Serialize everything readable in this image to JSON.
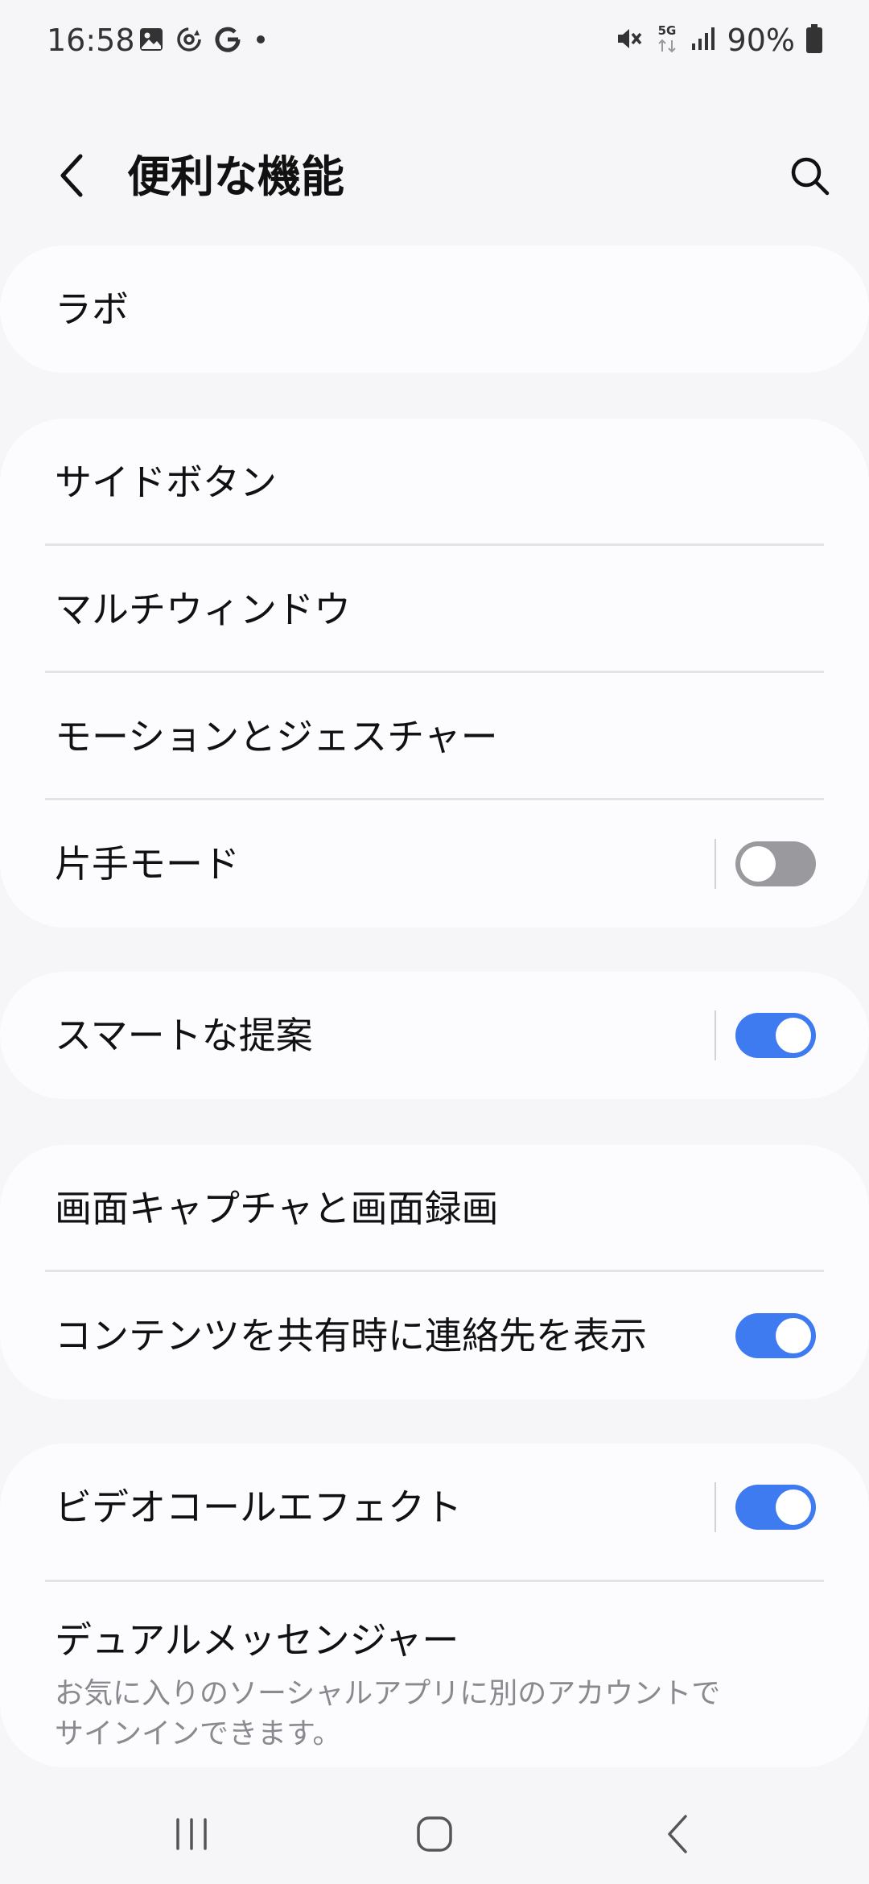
{
  "status_bar": {
    "time": "16:58",
    "left_icons": [
      "gallery-icon",
      "sync-icon",
      "google-icon",
      "dot-icon"
    ],
    "right_icons": [
      "mute-icon",
      "5g-icon",
      "signal-icon",
      "battery-icon"
    ],
    "battery": "90%",
    "network": "5G"
  },
  "header": {
    "title": "便利な機能",
    "back_icon": "chevron-left-icon",
    "search_icon": "search-icon"
  },
  "sections": {
    "labs": {
      "label": "ラボ"
    },
    "group1": {
      "side_button": "サイドボタン",
      "multi_window": "マルチウィンドウ",
      "motions": "モーションとジェスチャー",
      "one_hand": "片手モード",
      "one_hand_toggle": "off"
    },
    "smart_suggestions": {
      "label": "スマートな提案",
      "toggle": "on"
    },
    "group3": {
      "screenshots": "画面キャプチャと画面録画",
      "share_contacts": "コンテンツを共有時に連絡先を表示",
      "share_contacts_toggle": "on"
    },
    "group4": {
      "video_call": "ビデオコールエフェクト",
      "video_call_toggle": "on",
      "dual_messenger": "デュアルメッセンジャー",
      "dual_messenger_desc": "お気に入りのソーシャルアプリに別のアカウントでサインインできます。"
    }
  },
  "nav_bar": {
    "recent_icon": "recent-apps-icon",
    "home_icon": "home-icon",
    "back_icon": "back-icon"
  },
  "colors": {
    "background": "#f6f6f8",
    "card": "#fcfcff",
    "toggle_on": "#3e7af0",
    "toggle_off": "#9a9a9e",
    "secondary_text": "#8a8a8e"
  }
}
